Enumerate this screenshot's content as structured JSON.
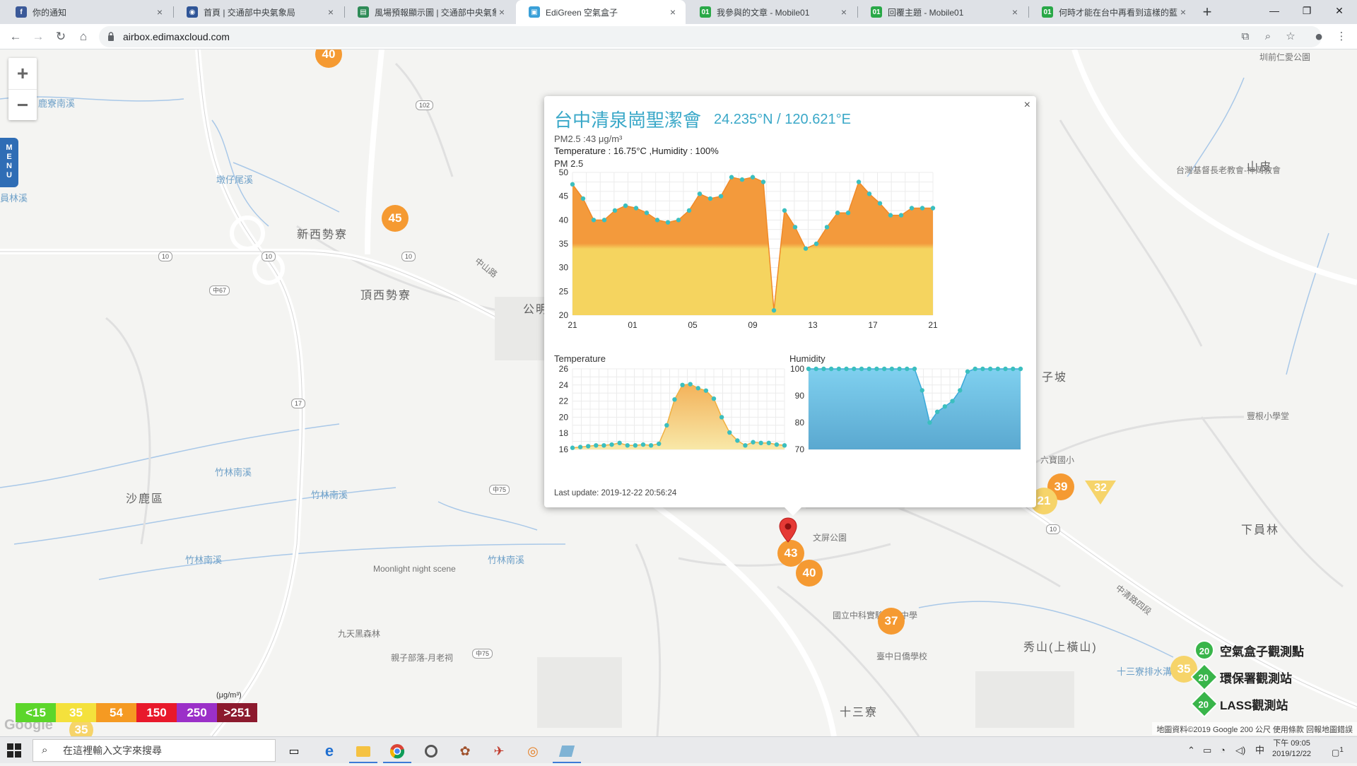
{
  "browser": {
    "tabs": [
      {
        "title": "你的通知",
        "color": "#3b5998",
        "glyph": "f"
      },
      {
        "title": "首頁 | 交通部中央氣象局",
        "color": "#2f5597",
        "glyph": "◉"
      },
      {
        "title": "風場預報顯示圖 | 交通部中央氣象局",
        "color": "#2e8b57",
        "glyph": "▤"
      },
      {
        "title": "EdiGreen 空氣盒子",
        "color": "#3aa0d8",
        "glyph": "▣"
      },
      {
        "title": "我參與的文章 - Mobile01",
        "color": "#29a847",
        "glyph": "01"
      },
      {
        "title": "回覆主題 - Mobile01",
        "color": "#29a847",
        "glyph": "01"
      },
      {
        "title": "何時才能在台中再看到這樣的藍天",
        "color": "#29a847",
        "glyph": "01"
      }
    ],
    "active_tab": 3,
    "url": "airbox.edimaxcloud.com"
  },
  "map": {
    "zoom_in": "+",
    "zoom_out": "−",
    "menu_label": "MENU",
    "labels": [
      {
        "text": "新西勢寮",
        "kind": "big"
      },
      {
        "text": "頂西勢寮",
        "kind": "big"
      },
      {
        "text": "沙鹿區",
        "kind": "big"
      },
      {
        "text": "秀山(上橫山)",
        "kind": "big"
      },
      {
        "text": "十三寮",
        "kind": "big"
      },
      {
        "text": "山皮",
        "kind": "big"
      },
      {
        "text": "下員林",
        "kind": "big"
      },
      {
        "text": "竹林南溪",
        "kind": "water"
      },
      {
        "text": "竹林南溪",
        "kind": "water"
      },
      {
        "text": "竹林南溪",
        "kind": "water"
      },
      {
        "text": "竹林南溪",
        "kind": "water"
      },
      {
        "text": "Moonlight night scene",
        "kind": "poi"
      },
      {
        "text": "九天黑森林",
        "kind": "poi"
      },
      {
        "text": "親子部落-月老祠",
        "kind": "poi"
      },
      {
        "text": "國立中科實驗高級中學",
        "kind": "poi"
      },
      {
        "text": "臺中日僑學校",
        "kind": "poi"
      },
      {
        "text": "台灣基督長老教會-神岡教會",
        "kind": "poi"
      },
      {
        "text": "豐根小學堂",
        "kind": "poi"
      },
      {
        "text": "六寶國小",
        "kind": "poi"
      },
      {
        "text": "子坡",
        "kind": "big"
      },
      {
        "text": "公明",
        "kind": "big"
      },
      {
        "text": "文屏公園",
        "kind": "poi"
      },
      {
        "text": "中清路四段",
        "kind": "road"
      },
      {
        "text": "十三寮排水溝",
        "kind": "water"
      },
      {
        "text": "中山路",
        "kind": "road"
      },
      {
        "text": "墩仔尾溪",
        "kind": "water"
      },
      {
        "text": "鹿寮南溪",
        "kind": "water"
      },
      {
        "text": "員林溪",
        "kind": "water"
      },
      {
        "text": "圳前仁愛公園",
        "kind": "poi"
      }
    ],
    "shields": [
      "102",
      "10",
      "10",
      "10",
      "中67",
      "17",
      "中75",
      "中75",
      "10"
    ],
    "markers": [
      {
        "value": "40",
        "style": "orange"
      },
      {
        "value": "45",
        "style": "orange"
      },
      {
        "value": "43",
        "style": "orange"
      },
      {
        "value": "40",
        "style": "orange"
      },
      {
        "value": "37",
        "style": "orange"
      },
      {
        "value": "39",
        "style": "orange"
      },
      {
        "value": "21",
        "style": "yellow"
      },
      {
        "value": "35",
        "style": "yellow"
      },
      {
        "value": "35",
        "style": "yellow"
      }
    ],
    "triangle_marker": "32",
    "scale_legend": {
      "unit": "(μg/m³)",
      "items": [
        {
          "label": "<15",
          "color": "#5cd62b"
        },
        {
          "label": "35",
          "color": "#f4e13c"
        },
        {
          "label": "54",
          "color": "#f59a22"
        },
        {
          "label": "150",
          "color": "#e8192b"
        },
        {
          "label": "250",
          "color": "#9b30c8"
        },
        {
          "label": ">251",
          "color": "#8c1a2e"
        }
      ]
    },
    "station_legend": [
      {
        "label": "空氣盒子觀測點",
        "value": "20"
      },
      {
        "label": "環保署觀測站",
        "value": "20"
      },
      {
        "label": "LASS觀測站",
        "value": "20"
      }
    ],
    "attribution": "地圖資料©2019 Google    200 公尺         使用條款    回報地圖錯誤",
    "google": "Google"
  },
  "popup": {
    "close": "×",
    "title": "台中清泉崗聖潔會",
    "coords": "24.235°N / 120.621°E",
    "pm25_line": "PM2.5 :43 μg/m³",
    "temp_line": "Temperature : 16.75°C ,Humidity : 100%",
    "pm_chart_label": "PM 2.5",
    "temp_chart_label": "Temperature",
    "hum_chart_label": "Humidity",
    "last_update": "Last update: 2019-12-22 20:56:24"
  },
  "chart_data": [
    {
      "type": "area",
      "title": "PM 2.5",
      "x_ticks": [
        "21",
        "01",
        "05",
        "09",
        "13",
        "17",
        "21"
      ],
      "ylim": [
        20,
        50
      ],
      "y_ticks": [
        20,
        25,
        30,
        35,
        40,
        45,
        50
      ],
      "values": [
        47.5,
        44.5,
        40,
        40,
        42,
        43,
        42.5,
        41.5,
        40,
        39.5,
        40,
        42,
        45.5,
        44.5,
        45,
        49,
        48.5,
        49,
        48,
        21,
        42,
        38.5,
        34,
        35,
        38.5,
        41.5,
        41.5,
        48,
        45.5,
        43.5,
        41,
        41,
        42.5,
        42.5,
        42.5
      ],
      "grid": true
    },
    {
      "type": "area",
      "title": "Temperature",
      "ylim": [
        16,
        26
      ],
      "y_ticks": [
        16,
        18,
        20,
        22,
        24,
        26
      ],
      "values": [
        16.2,
        16.3,
        16.4,
        16.5,
        16.5,
        16.6,
        16.8,
        16.5,
        16.5,
        16.6,
        16.5,
        16.7,
        19,
        22.2,
        24,
        24.1,
        23.6,
        23.3,
        22.3,
        20,
        18.1,
        17.1,
        16.5,
        16.9,
        16.8,
        16.8,
        16.6,
        16.5
      ],
      "grid": true
    },
    {
      "type": "area",
      "title": "Humidity",
      "ylim": [
        70,
        100
      ],
      "y_ticks": [
        70,
        80,
        90,
        100
      ],
      "values": [
        100,
        100,
        100,
        100,
        100,
        100,
        100,
        100,
        100,
        100,
        100,
        100,
        100,
        100,
        100,
        92,
        80,
        84,
        86,
        88,
        92,
        99,
        100,
        100,
        100,
        100,
        100,
        100,
        100
      ],
      "grid": true
    }
  ],
  "taskbar": {
    "search_placeholder": "在這裡輸入文字來搜尋",
    "ime": "中",
    "time": "下午 09:05",
    "date": "2019/12/22",
    "notifications": "1"
  }
}
